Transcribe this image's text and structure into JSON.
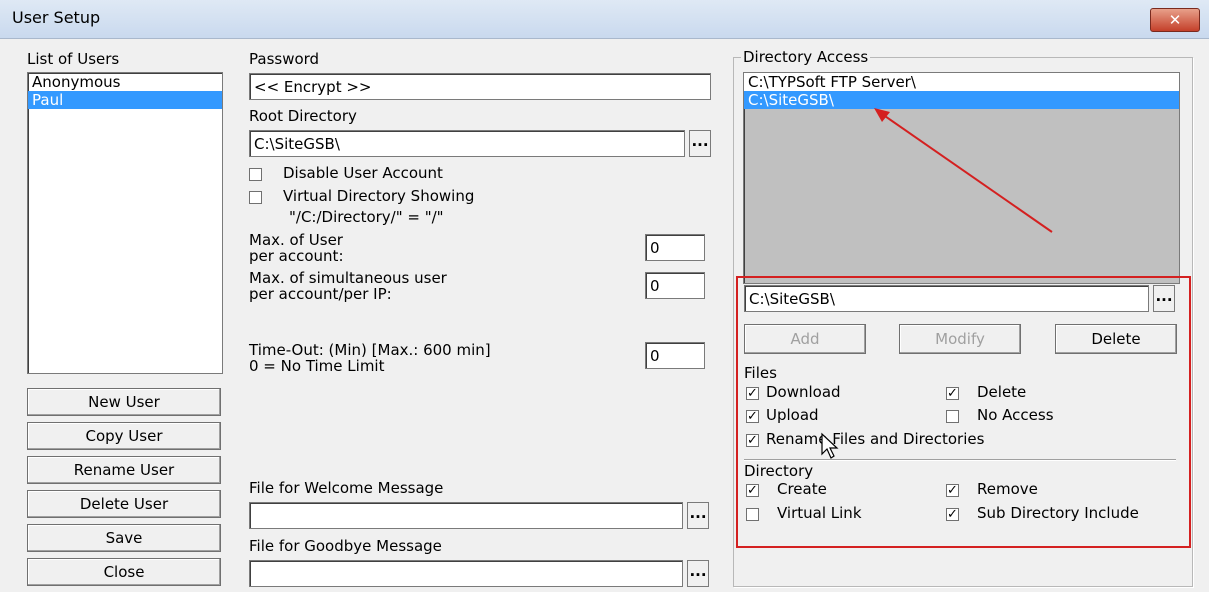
{
  "window": {
    "title": "User Setup",
    "close_icon": "close-icon",
    "close_color": "#c4402a"
  },
  "users": {
    "header": "List of Users",
    "items": [
      "Anonymous",
      "Paul"
    ],
    "selected": "Paul"
  },
  "buttons": {
    "new_user": "New User",
    "copy_user": "Copy User",
    "rename_user": "Rename User",
    "delete_user": "Delete User",
    "save": "Save",
    "close": "Close"
  },
  "password": {
    "label": "Password",
    "value": "<< Encrypt >>"
  },
  "root_dir": {
    "label": "Root Directory",
    "value": "C:\\SiteGSB\\",
    "browse": "..."
  },
  "options": {
    "disable_account": "Disable User Account",
    "virtual_dir": "Virtual Directory Showing",
    "virtual_dir_example": "\"/C:/Directory/\" = \"/\""
  },
  "limits": {
    "max_user_line1": "Max. of User",
    "max_user_line2": "per account:",
    "max_user_value": "0",
    "max_sim_line1": "Max. of simultaneous user",
    "max_sim_line2": "per account/per IP:",
    "max_sim_value": "0",
    "timeout_line1": "Time-Out: (Min) [Max.: 600 min]",
    "timeout_line2": "0 = No Time Limit",
    "timeout_value": "0"
  },
  "messages": {
    "welcome_label": "File for Welcome Message",
    "welcome_value": "",
    "goodbye_label": "File for Goodbye Message",
    "goodbye_value": "",
    "browse": "..."
  },
  "directory_access": {
    "title": "Directory Access",
    "items": [
      "C:\\TYPSoft FTP Server\\",
      "C:\\SiteGSB\\"
    ],
    "selected": "C:\\SiteGSB\\",
    "path_value": "C:\\SiteGSB\\",
    "browse": "...",
    "add": "Add",
    "modify": "Modify",
    "delete": "Delete",
    "highlight_color": "#d42020",
    "arrow_color": "#d42020"
  },
  "files": {
    "label": "Files",
    "download": {
      "label": "Download",
      "checked": true,
      "mark": "✓"
    },
    "delete": {
      "label": "Delete",
      "checked": true,
      "mark": "✓"
    },
    "upload": {
      "label": "Upload",
      "checked": true,
      "mark": "✓"
    },
    "no_access": {
      "label": "No Access",
      "checked": false,
      "mark": ""
    },
    "rename": {
      "label": "Rename Files and Directories",
      "checked": true,
      "mark": "✓"
    }
  },
  "directory": {
    "label": "Directory",
    "create": {
      "label": "Create",
      "checked": true,
      "mark": "✓"
    },
    "remove": {
      "label": "Remove",
      "checked": true,
      "mark": "✓"
    },
    "virtual_link": {
      "label": "Virtual Link",
      "checked": false,
      "mark": ""
    },
    "sub_dir": {
      "label": "Sub Directory Include",
      "checked": true,
      "mark": "✓"
    }
  }
}
